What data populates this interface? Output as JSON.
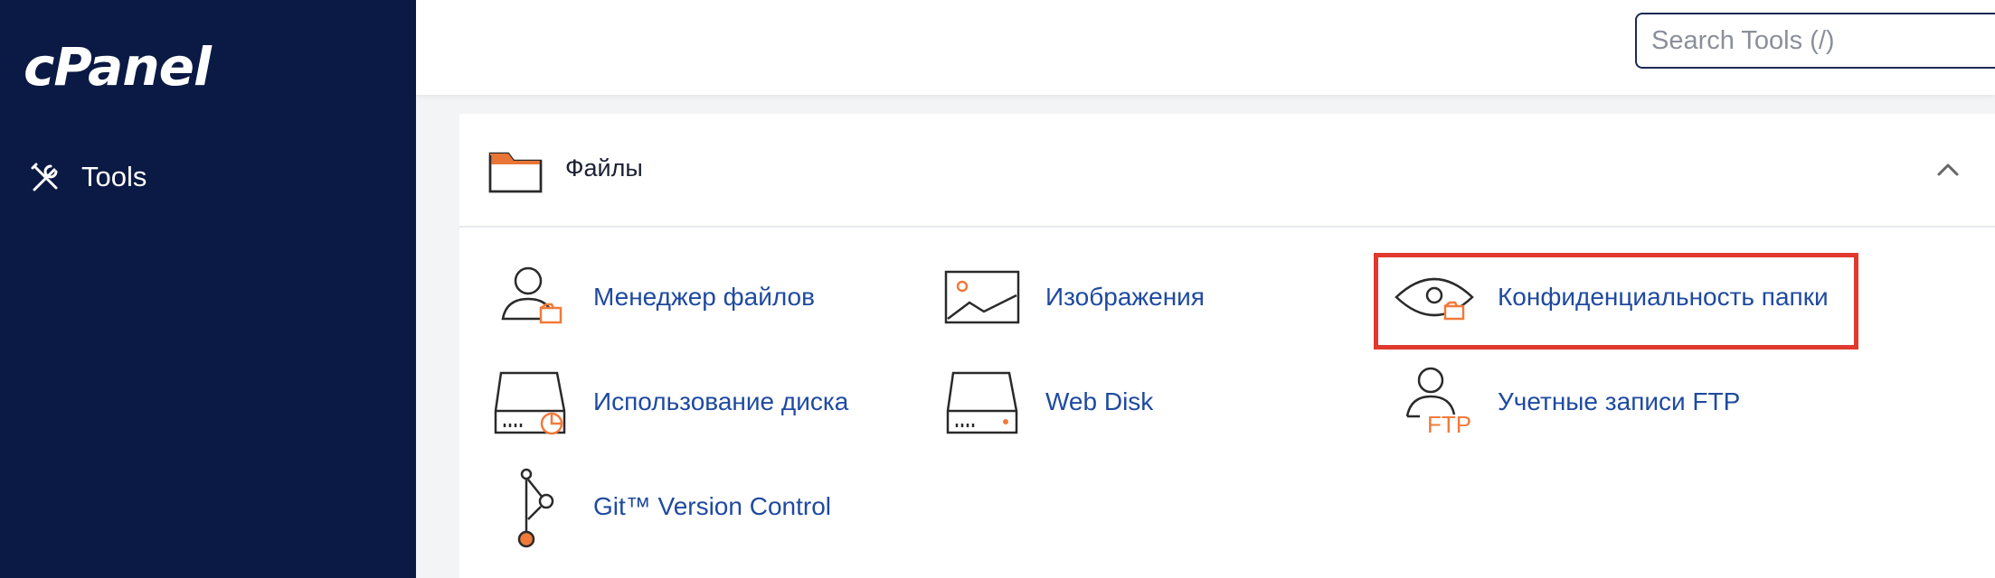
{
  "sidebar": {
    "logo": "cPanel",
    "items": [
      {
        "label": "Tools",
        "icon": "tools-icon"
      }
    ]
  },
  "search": {
    "placeholder": "Search Tools (/)",
    "value": ""
  },
  "section": {
    "title": "Файлы",
    "icon": "folder-icon",
    "collapse_icon": "chevron-up-icon",
    "tools": [
      {
        "label": "Менеджер файлов",
        "icon": "file-manager-icon"
      },
      {
        "label": "Изображения",
        "icon": "images-icon"
      },
      {
        "label": "Конфиденциальность папки",
        "icon": "directory-privacy-icon"
      },
      {
        "label": "Использование диска",
        "icon": "disk-usage-icon"
      },
      {
        "label": "Web Disk",
        "icon": "web-disk-icon"
      },
      {
        "label": "Учетные записи FTP",
        "icon": "ftp-accounts-icon"
      },
      {
        "label": "Git™ Version Control",
        "icon": "git-icon"
      }
    ]
  },
  "icon_text": {
    "ftp": "FTP"
  },
  "colors": {
    "sidebar_bg": "#0b1a44",
    "accent_orange": "#f07a3a",
    "link_blue": "#1f4aa0",
    "highlight_red": "#e03a2f"
  }
}
